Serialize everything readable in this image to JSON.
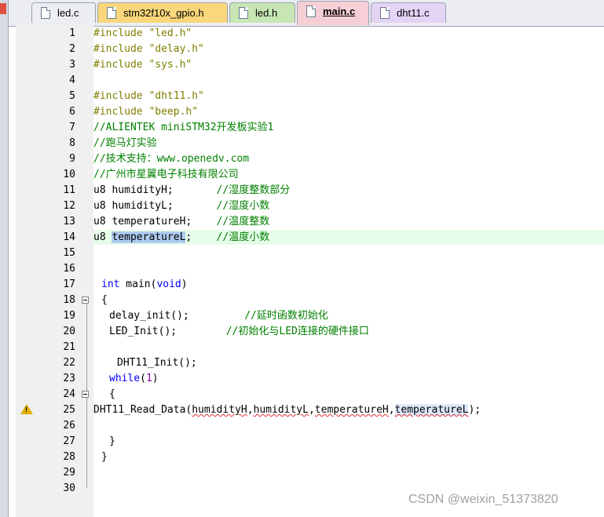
{
  "tabs": [
    {
      "label": "led.c",
      "active": false,
      "color": "#eceef2"
    },
    {
      "label": "stm32f10x_gpio.h",
      "active": false,
      "color": "#f9d77a"
    },
    {
      "label": "led.h",
      "active": false,
      "color": "#c7e6b4"
    },
    {
      "label": "main.c",
      "active": true,
      "color": "#f6cfd6"
    },
    {
      "label": "dht11.c",
      "active": false,
      "color": "#e4d4f4"
    }
  ],
  "line_numbers": [
    "1",
    "2",
    "3",
    "4",
    "5",
    "6",
    "7",
    "8",
    "9",
    "10",
    "11",
    "12",
    "13",
    "14",
    "15",
    "16",
    "17",
    "18",
    "19",
    "20",
    "21",
    "22",
    "23",
    "24",
    "25",
    "26",
    "27",
    "28",
    "29",
    "30"
  ],
  "code": {
    "l1": "#include \"led.h\"",
    "l2": "#include \"delay.h\"",
    "l3": "#include \"sys.h\"",
    "l5": "#include \"dht11.h\"",
    "l6": "#include \"beep.h\"",
    "l7": "//ALIENTEK miniSTM32开发板实验1",
    "l8": "//跑马灯实验",
    "l9": "//技术支持：www.openedv.com",
    "l10": "//广州市星翼电子科技有限公司",
    "l11_decl": "u8 humidityH;       ",
    "l11_cm": "//湿度整数部分",
    "l12_decl": "u8 humidityL;       ",
    "l12_cm": "//湿度小数",
    "l13_decl": "u8 temperatureH;    ",
    "l13_cm": "//温度整数",
    "l14_type": "u8 ",
    "l14_var": "temperatureL",
    "l14_rest": ";    ",
    "l14_cm": "//温度小数",
    "l17_int": "int",
    "l17_main": " main(",
    "l17_void": "void",
    "l17_close": ")",
    "l18": "{",
    "l19_code": "delay_init();         ",
    "l19_cm": "//延时函数初始化",
    "l20_code": "LED_Init();        ",
    "l20_cm": "//初始化与LED连接的硬件接口",
    "l22": "DHT11_Init();",
    "l23_kw": "while",
    "l23_open": "(",
    "l23_num": "1",
    "l23_close": ")",
    "l24": "{",
    "l25_fn": "DHT11_Read_Data(",
    "l25_a1": "humidityH",
    "l25_c1": ",",
    "l25_a2": "humidityL",
    "l25_c2": ",",
    "l25_a3": "temperatureH",
    "l25_c3": ",",
    "l25_a4": "temperatureL",
    "l25_end": ");",
    "l27": "}",
    "l28": "}"
  },
  "watermark": "CSDN @weixin_51373820",
  "warning_glyph": "!"
}
